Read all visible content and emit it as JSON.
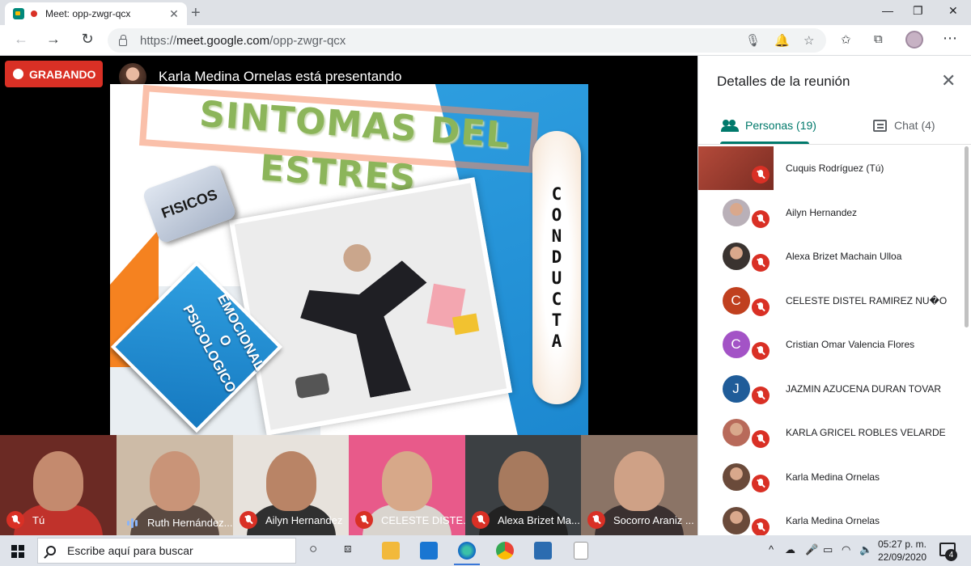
{
  "browser": {
    "tab_title": "Meet: opp-zwgr-qcx",
    "tab_close": "✕",
    "new_tab": "+",
    "window_controls": {
      "minimize": "—",
      "restore": "❐",
      "close": "✕"
    },
    "nav": {
      "back": "←",
      "forward": "→",
      "reload": "↻"
    },
    "url_prefix": "https://",
    "url_host": "meet.google.com",
    "url_path": "/opp-zwgr-qcx",
    "toolbar_icons": [
      "mic-icon",
      "notification-blocked-icon",
      "star-icon",
      "favorites-icon",
      "collections-icon",
      "profile-icon",
      "more-icon"
    ]
  },
  "meeting": {
    "recording_label": "GRABANDO",
    "presenter_text": "Karla Medina Ornelas está presentando"
  },
  "slide": {
    "title_line1": "SINTOMAS DEL",
    "title_line2": "ESTRES",
    "physical_label": "FISICOS",
    "emotional_lines": [
      "EMOCIONAL",
      "O",
      "PSICOLOGICO"
    ],
    "conduct_letters": [
      "C",
      "O",
      "N",
      "D",
      "U",
      "C",
      "T",
      "A"
    ]
  },
  "filmstrip": [
    {
      "name": "Tú",
      "mic": "muted",
      "bg": "#6b2a24",
      "face": "#c48a6e",
      "body": "#c0322b"
    },
    {
      "name": "Ruth Hernández...",
      "mic": "speaking",
      "bg": "#cdbba7",
      "face": "#c99478",
      "body": "#5a4a42"
    },
    {
      "name": "Ailyn Hernandez",
      "mic": "muted",
      "bg": "#e7e2dc",
      "face": "#b98466",
      "body": "#303030"
    },
    {
      "name": "CELESTE DISTE...",
      "mic": "muted",
      "bg": "#e85a8a",
      "face": "#d7a889",
      "body": "#d9d4ce"
    },
    {
      "name": "Alexa Brizet Ma...",
      "mic": "muted",
      "bg": "#3c4043",
      "face": "#a77a5e",
      "body": "#222"
    },
    {
      "name": "Socorro Araniz ...",
      "mic": "muted",
      "bg": "#8b7466",
      "face": "#cfa186",
      "body": "#3a3030"
    }
  ],
  "panel": {
    "title": "Detalles de la reunión",
    "close": "✕",
    "people_tab": "Personas (19)",
    "chat_tab": "Chat (4)",
    "participants": [
      {
        "name": "Cuquis Rodríguez (Tú)",
        "initial": "",
        "color": "#b44a3a",
        "self": true
      },
      {
        "name": "Ailyn Hernandez",
        "initial": "",
        "color": "#b9b0b8",
        "self": false
      },
      {
        "name": "Alexa Brizet Machain Ulloa",
        "initial": "",
        "color": "#3a3330",
        "self": false
      },
      {
        "name": "CELESTE DISTEL RAMIREZ NU�O",
        "initial": "C",
        "color": "#c0401f",
        "self": false
      },
      {
        "name": "Cristian Omar Valencia Flores",
        "initial": "C",
        "color": "#a353c6",
        "self": false
      },
      {
        "name": "JAZMIN AZUCENA DURAN TOVAR",
        "initial": "J",
        "color": "#1f5c99",
        "self": false
      },
      {
        "name": "KARLA GRICEL ROBLES VELARDE",
        "initial": "",
        "color": "#b86a5a",
        "self": false
      },
      {
        "name": "Karla Medina Ornelas",
        "initial": "",
        "color": "#6a4a3a",
        "self": false
      },
      {
        "name": "Karla Medina Ornelas",
        "initial": "",
        "color": "#6a4a3a",
        "self": false
      }
    ]
  },
  "taskbar": {
    "search_placeholder": "Escribe aquí para buscar",
    "time": "05:27 p. m.",
    "date": "22/09/2020",
    "notifications": "4",
    "tray_arrow": "^"
  }
}
